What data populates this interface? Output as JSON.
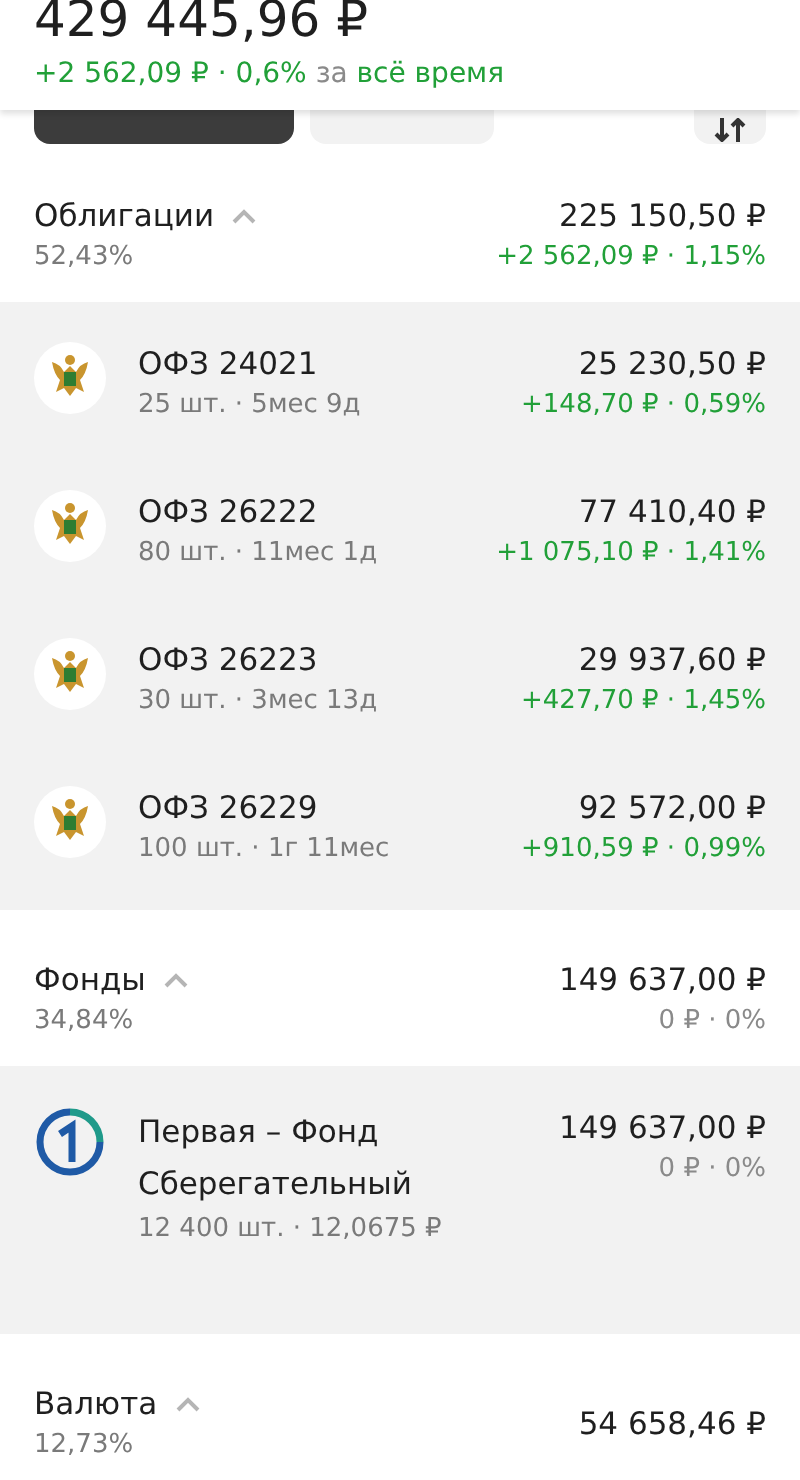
{
  "summary": {
    "total": "429 445,96 ₽",
    "change": "+2 562,09 ₽ · 0,6%",
    "period_prefix": "за",
    "period": "всё время"
  },
  "filters": [
    {
      "selected": true
    },
    {
      "selected": false
    }
  ],
  "sections": [
    {
      "title": "Облигации",
      "expanded": true,
      "share": "52,43%",
      "value": "225 150,50 ₽",
      "change": "+2 562,09 ₽ · 1,15%",
      "positive": true,
      "items": [
        {
          "kind": "bond",
          "name": "ОФЗ 24021",
          "details": "25 шт. · 5мес 9д",
          "value": "25 230,50 ₽",
          "change": "+148,70 ₽ · 0,59%",
          "positive": true
        },
        {
          "kind": "bond",
          "name": "ОФЗ 26222",
          "details": "80 шт. · 11мес 1д",
          "value": "77 410,40 ₽",
          "change": "+1 075,10 ₽ · 1,41%",
          "positive": true
        },
        {
          "kind": "bond",
          "name": "ОФЗ 26223",
          "details": "30 шт. · 3мес 13д",
          "value": "29 937,60 ₽",
          "change": "+427,70 ₽ · 1,45%",
          "positive": true
        },
        {
          "kind": "bond",
          "name": "ОФЗ 26229",
          "details": "100 шт. · 1г 11мес",
          "value": "92 572,00 ₽",
          "change": "+910,59 ₽ · 0,99%",
          "positive": true
        }
      ]
    },
    {
      "title": "Фонды",
      "expanded": true,
      "share": "34,84%",
      "value": "149 637,00 ₽",
      "change": "0 ₽ · 0%",
      "positive": false,
      "items": [
        {
          "kind": "fund",
          "name": "Первая – Фонд Сберегательный",
          "details": "12 400 шт. · 12,0675 ₽",
          "value": "149 637,00 ₽",
          "change": "0 ₽ · 0%",
          "positive": false
        }
      ]
    },
    {
      "title": "Валюта",
      "expanded": true,
      "share": "12,73%",
      "value": "54 658,46 ₽"
    }
  ]
}
